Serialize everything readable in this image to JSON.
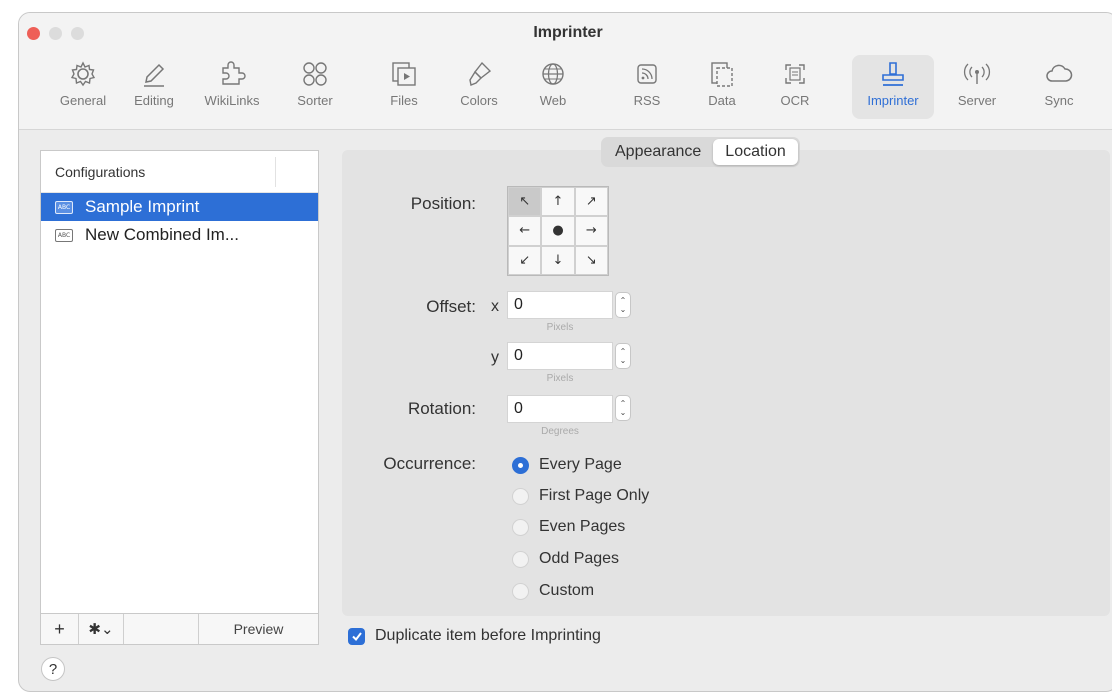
{
  "window": {
    "title": "Imprinter"
  },
  "toolbar": {
    "tabs": [
      {
        "label": "General",
        "icon": "gear-icon"
      },
      {
        "label": "Editing",
        "icon": "pencil-icon"
      },
      {
        "label": "WikiLinks",
        "icon": "puzzle-icon"
      },
      {
        "label": "Sorter",
        "icon": "circles-icon"
      },
      {
        "label": "Files",
        "icon": "files-icon"
      },
      {
        "label": "Colors",
        "icon": "paintbrush-icon"
      },
      {
        "label": "Web",
        "icon": "globe-icon"
      },
      {
        "label": "RSS",
        "icon": "rss-icon"
      },
      {
        "label": "Data",
        "icon": "data-icon"
      },
      {
        "label": "OCR",
        "icon": "ocr-icon"
      },
      {
        "label": "Imprinter",
        "icon": "stamp-icon"
      },
      {
        "label": "Server",
        "icon": "antenna-icon"
      },
      {
        "label": "Sync",
        "icon": "cloud-icon"
      }
    ],
    "active_tab": "Imprinter",
    "accent_color": "#2f6fd6"
  },
  "configurations": {
    "header": "Configurations",
    "items": [
      {
        "label": "Sample Imprint",
        "selected": true
      },
      {
        "label": "New Combined Im...",
        "selected": false
      }
    ],
    "footer": {
      "add": "+",
      "gear": "✱⌄",
      "preview": "Preview"
    }
  },
  "segmented": {
    "appearance": "Appearance",
    "location": "Location",
    "selected": "Location"
  },
  "position": {
    "label": "Position:",
    "selected": "top-left",
    "arrows": [
      "↖",
      "↑",
      "↗",
      "←",
      "●",
      "→",
      "↙",
      "↓",
      "↘"
    ]
  },
  "offset": {
    "label": "Offset:",
    "x_label": "x",
    "x_value": "0",
    "x_unit": "Pixels",
    "y_label": "y",
    "y_value": "0",
    "y_unit": "Pixels"
  },
  "rotation": {
    "label": "Rotation:",
    "value": "0",
    "unit": "Degrees"
  },
  "occurrence": {
    "label": "Occurrence:",
    "options": [
      "Every Page",
      "First Page Only",
      "Even Pages",
      "Odd Pages",
      "Custom"
    ],
    "selected": "Every Page"
  },
  "duplicate": {
    "label": "Duplicate item before Imprinting",
    "checked": true
  },
  "help": {
    "label": "?"
  },
  "stepper_glyphs": {
    "up": "⌃",
    "down": "⌄"
  }
}
